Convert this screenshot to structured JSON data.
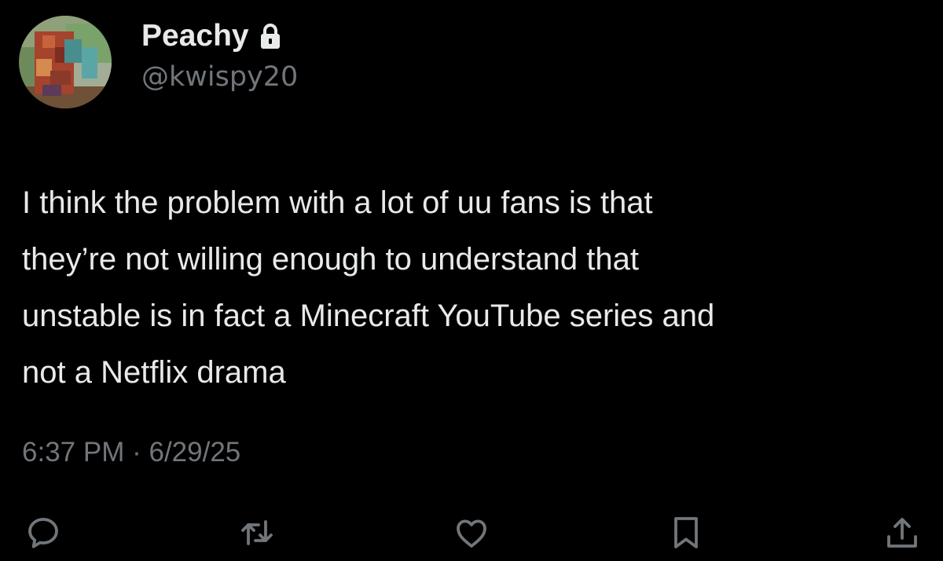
{
  "user": {
    "display_name": "Peachy",
    "handle": "@kwispy20",
    "avatar_icon": "minecraft-skin-avatar",
    "lock_icon": "lock-icon"
  },
  "tweet": {
    "text": "I think the problem with a lot of uu fans is that\nthey’re not willing enough to understand that\nunstable is in fact a Minecraft YouTube series  and\nnot a Netflix drama",
    "time": "6:37 PM",
    "separator": "·",
    "date": "6/29/25"
  },
  "actions": [
    {
      "icon": "reply-icon"
    },
    {
      "icon": "repost-icon"
    },
    {
      "icon": "like-icon"
    },
    {
      "icon": "bookmark-icon"
    },
    {
      "icon": "share-icon"
    }
  ],
  "colors": {
    "background": "#000000",
    "primary_text": "#e7e9ea",
    "secondary_text": "#71767b"
  }
}
